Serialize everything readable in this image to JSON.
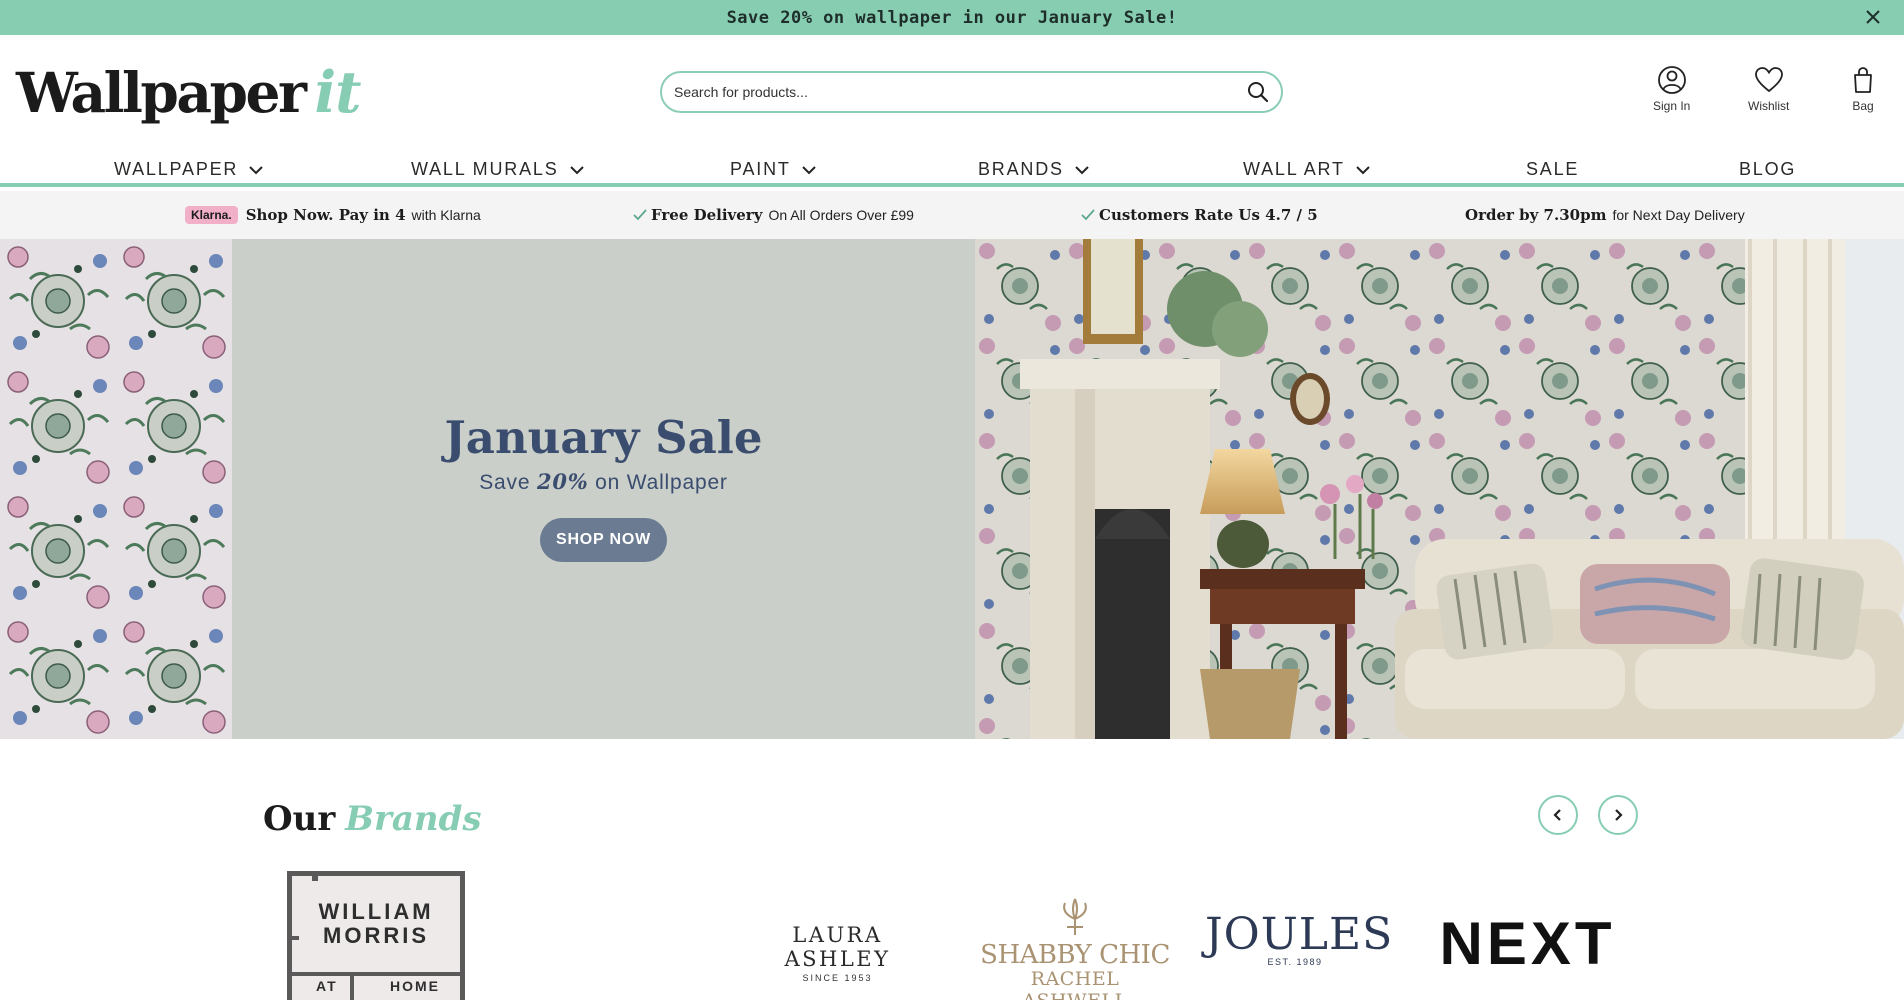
{
  "promo": {
    "text": "Save 20% on wallpaper in our January Sale!"
  },
  "header": {
    "logo_main": "Wallpaper",
    "logo_it": "it",
    "search_placeholder": "Search for products...",
    "account": [
      {
        "label": "Sign In",
        "icon": "user-icon"
      },
      {
        "label": "Wishlist",
        "icon": "heart-icon"
      },
      {
        "label": "Bag",
        "icon": "bag-icon"
      }
    ]
  },
  "nav": {
    "items": [
      {
        "label": "WALLPAPER",
        "dropdown": true
      },
      {
        "label": "WALL MURALS",
        "dropdown": true
      },
      {
        "label": "PAINT",
        "dropdown": true
      },
      {
        "label": "BRANDS",
        "dropdown": true
      },
      {
        "label": "WALL ART",
        "dropdown": true
      },
      {
        "label": "SALE",
        "dropdown": false
      },
      {
        "label": "BLOG",
        "dropdown": false
      }
    ]
  },
  "usp": {
    "klarna_badge": "Klarna.",
    "klarna_bold": "Shop Now. Pay in 4",
    "klarna_light": "with Klarna",
    "delivery_bold": "Free Delivery",
    "delivery_light": "On All Orders Over £99",
    "rating_bold": "Customers Rate Us 4.7 / 5",
    "order_bold": "Order by 7.30pm",
    "order_light": "for Next Day Delivery"
  },
  "hero": {
    "title": "January Sale",
    "sub_prefix": "Save ",
    "sub_percent": "20%",
    "sub_suffix": " on Wallpaper",
    "button": "SHOP NOW"
  },
  "brands": {
    "title_our": "Our",
    "title_brands": "Brands",
    "logos": {
      "william_morris_line1": "WILLIAM",
      "william_morris_line2": "MORRIS",
      "william_morris_at": "AT",
      "william_morris_home": "HOME",
      "laura_ashley": "LAURA ASHLEY",
      "laura_ashley_sub": "SINCE 1953",
      "shabby_chic": "SHABBY CHIC",
      "shabby_chic_sub": "RACHEL ASHWELL",
      "joules": "JOULES",
      "joules_sub": "EST. 1989",
      "next": "NEXT"
    }
  },
  "colors": {
    "accent": "#87cdb2",
    "hero_panel": "#cbcfca",
    "hero_text": "#3a4d6e",
    "hero_button": "#6b7b92"
  }
}
